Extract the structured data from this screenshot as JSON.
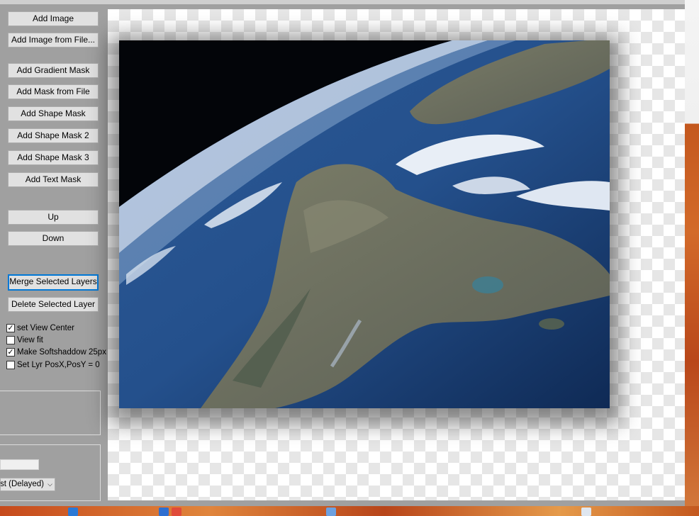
{
  "buttons": {
    "add_image": "Add Image",
    "add_image_from_file": "Add Image from File...",
    "add_gradient_mask": "Add Gradient Mask",
    "add_mask_from_file": "Add Mask from File",
    "add_shape_mask": "Add Shape Mask",
    "add_shape_mask_2": "Add Shape Mask 2",
    "add_shape_mask_3": "Add Shape Mask 3",
    "add_text_mask": "Add Text Mask",
    "up": "Up",
    "down": "Down",
    "merge_selected_layers": "Merge Selected Layers",
    "delete_selected_layer": "Delete Selected Layer"
  },
  "options": {
    "set_view_center": {
      "label": "set View Center",
      "checked": true
    },
    "view_fit": {
      "label": "View fit",
      "checked": false
    },
    "make_softshadow": {
      "label": "Make Softshaddow 25px",
      "checked": true
    },
    "set_lyr_pos": {
      "label": "Set Lyr PosX,PosY = 0",
      "checked": false
    }
  },
  "quality_select": {
    "value": "st (Delayed)"
  },
  "canvas": {
    "image_subject": "satellite view of a coastline with clouds"
  },
  "colors": {
    "focus": "#0078d7",
    "panel": "#a0a0a0",
    "button": "#e1e1e1"
  }
}
